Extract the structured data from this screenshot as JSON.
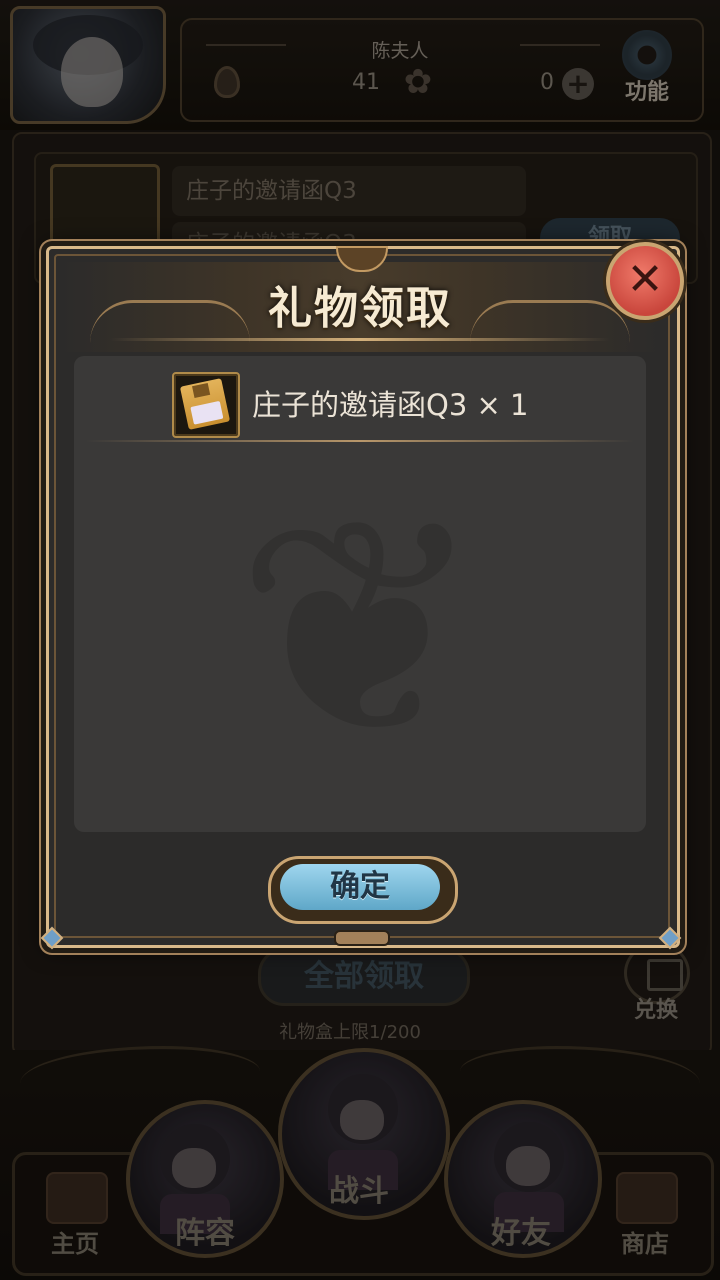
{
  "header": {
    "player_name": "陈夫人",
    "stat1": "41",
    "stat2": "0",
    "func_label": "功能"
  },
  "gift_list": {
    "row_item_name": "庄子的邀请函Q3",
    "row_item_name2": "庄子的邀请函Q3",
    "claim_label": "领取",
    "claim_all_label": "全部领取",
    "exchange_label": "兑换",
    "capacity": "礼物盒上限1/200"
  },
  "nav": {
    "home": "主页",
    "team": "阵容",
    "battle": "战斗",
    "friends": "好友",
    "shop": "商店"
  },
  "dialog": {
    "title": "礼物领取",
    "reward_text": "庄子的邀请函Q3 × 1",
    "confirm_label": "确定"
  },
  "colors": {
    "frame_gold": "#d9b98a",
    "close_red": "#d45546",
    "confirm_blue": "#7fbfdc",
    "content_bg": "#3a3938"
  },
  "icons": [
    "fire-icon",
    "butterfly-icon",
    "plus-icon",
    "gear-icon",
    "gift-icon",
    "close-icon",
    "floppy-disk-icon",
    "house-icon",
    "treasure-chest-icon"
  ]
}
